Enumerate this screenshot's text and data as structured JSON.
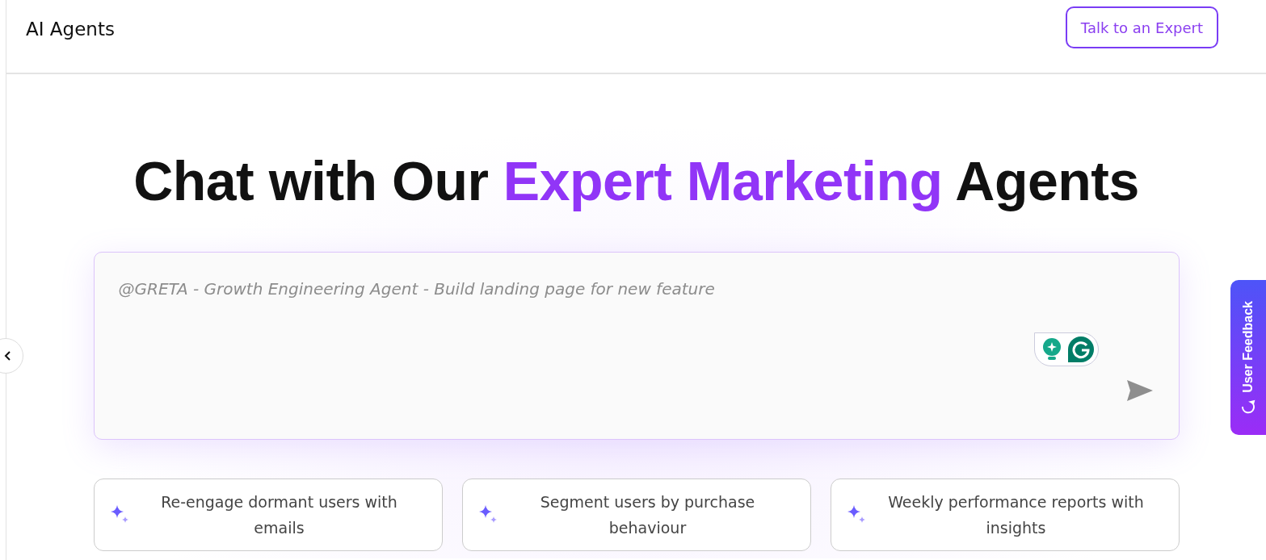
{
  "header": {
    "title": "AI Agents",
    "cta": "Talk to an Expert"
  },
  "heading": {
    "before": "Chat with Our",
    "highlight": "Expert Marketing",
    "after": "Agents"
  },
  "prompt": {
    "placeholder": "@GRETA - Growth Engineering Agent - Build landing page for new feature"
  },
  "suggestions": [
    {
      "label": "Re-engage dormant users with emails"
    },
    {
      "label": "Segment users by purchase behaviour"
    },
    {
      "label": "Weekly performance reports with insights"
    }
  ],
  "feedback_tab": {
    "label": "User Feedback"
  }
}
